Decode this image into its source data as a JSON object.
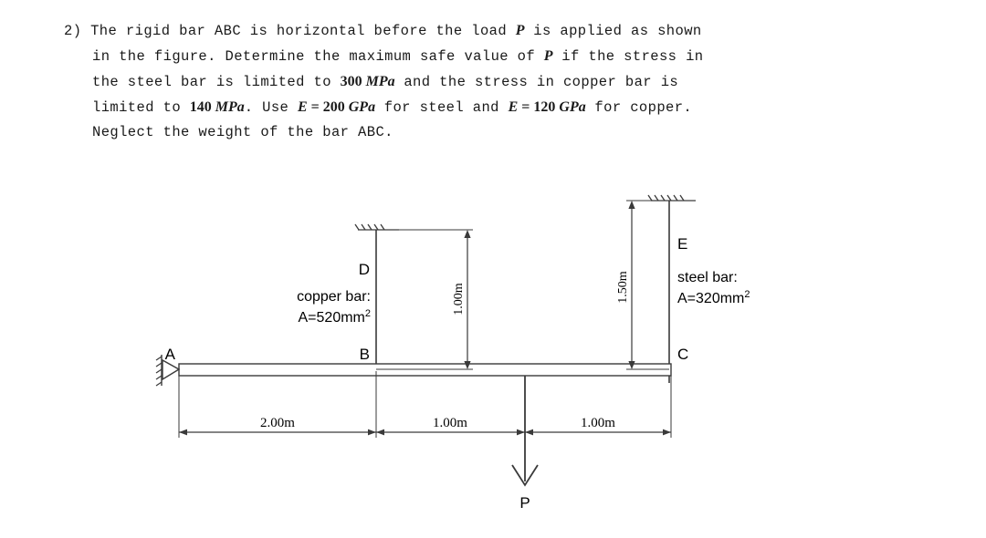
{
  "problem": {
    "number": "2)",
    "lines": [
      [
        {
          "t": "text",
          "v": "The rigid bar ABC is horizontal before the load "
        },
        {
          "t": "mathit",
          "v": "P"
        },
        {
          "t": "text",
          "v": " is applied as shown"
        }
      ],
      [
        {
          "t": "text",
          "v": "in the figure. Determine the maximum safe value of "
        },
        {
          "t": "mathit",
          "v": "P"
        },
        {
          "t": "text",
          "v": " if the stress in"
        }
      ],
      [
        {
          "t": "text",
          "v": "the steel bar is limited to "
        },
        {
          "t": "mathnum",
          "v": "300"
        },
        {
          "t": "mathit",
          "v": " MPa"
        },
        {
          "t": "text",
          "v": " and the stress in copper bar is"
        }
      ],
      [
        {
          "t": "text",
          "v": "limited to "
        },
        {
          "t": "mathnum",
          "v": "140"
        },
        {
          "t": "mathit",
          "v": " MPa"
        },
        {
          "t": "text",
          "v": ". Use "
        },
        {
          "t": "mathit",
          "v": "E"
        },
        {
          "t": "mathnum",
          "v": " = 200"
        },
        {
          "t": "mathit",
          "v": " GPa"
        },
        {
          "t": "text",
          "v": " for steel and "
        },
        {
          "t": "mathit",
          "v": "E"
        },
        {
          "t": "mathnum",
          "v": " = 120"
        },
        {
          "t": "mathit",
          "v": " GPa"
        },
        {
          "t": "text",
          "v": " for copper."
        }
      ],
      [
        {
          "t": "text",
          "v": "Neglect the weight of the bar ABC."
        }
      ]
    ]
  },
  "figure": {
    "points": {
      "A": "A",
      "B": "B",
      "C": "C",
      "D": "D",
      "E": "E"
    },
    "copper_bar": {
      "title": "copper bar:",
      "area_prefix": "A=520mm",
      "area_exponent": "2"
    },
    "steel_bar": {
      "title": "steel bar:",
      "area_prefix": "A=320mm",
      "area_exponent": "2"
    },
    "dimensions": {
      "horizontal": [
        "2.00m",
        "1.00m",
        "1.00m"
      ],
      "copper_length": "1.00m",
      "steel_length": "1.50m"
    },
    "load": {
      "label": "P"
    },
    "colors": {
      "line": "#3a3a3a",
      "text": "#000000",
      "background": "#ffffff"
    }
  }
}
